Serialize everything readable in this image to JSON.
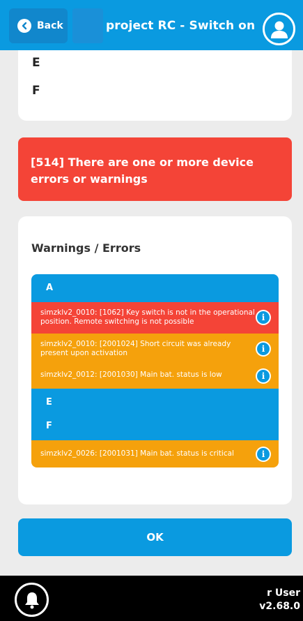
{
  "header": {
    "back_label": "Back",
    "title": "project RC - Switch on"
  },
  "top_card": {
    "items": [
      "E",
      "F"
    ]
  },
  "error_banner": {
    "text": "[514] There are one or more device errors or warnings"
  },
  "warnings": {
    "title": "Warnings / Errors",
    "group_a": "A",
    "row1": "simzklv2_0010: [1062] Key switch is not in the operational position. Remote switching is not possible",
    "row2": "simzklv2_0010: [2001024] Short circuit was already present upon activation",
    "row3": "simzklv2_0012: [2001030] Main bat. status is low",
    "group_e": "E",
    "group_f": "F",
    "row4": "simzklv2_0026: [2001031] Main bat. status is critical",
    "info_glyph": "i"
  },
  "ok_label": "OK",
  "footer": {
    "user": "r User",
    "version": "v2.68.0"
  },
  "colors": {
    "primary": "#0a9ae0",
    "error": "#f44437",
    "warning": "#f5a10c"
  },
  "icons": [
    "back-chevron-icon",
    "user-icon",
    "info-icon",
    "bell-icon"
  ]
}
